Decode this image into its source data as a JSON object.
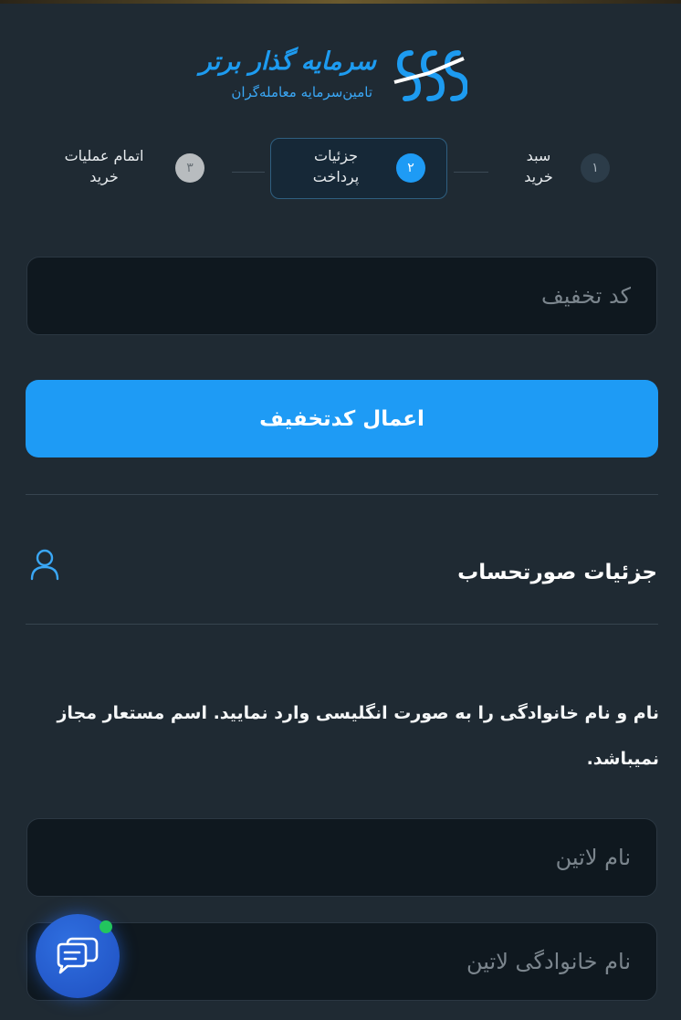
{
  "logo": {
    "title": "سرمایه گذار برتر",
    "subtitle": "تامین‌سرمایه معامله‌گران"
  },
  "stepper": {
    "steps": [
      {
        "number": "۱",
        "label_line1": "سبد",
        "label_line2": "خرید",
        "state": "done"
      },
      {
        "number": "۲",
        "label_line1": "جزئیات",
        "label_line2": "پرداخت",
        "state": "active"
      },
      {
        "number": "۳",
        "label_line1": "اتمام عملیات",
        "label_line2": "خرید",
        "state": "pending"
      }
    ]
  },
  "discount": {
    "placeholder": "کد تخفیف",
    "apply_label": "اعمال کدتخفیف"
  },
  "billing": {
    "title": "جزئیات صورتحساب",
    "notice": "نام و نام خانوادگی را به صورت انگلیسی وارد نمایید. اسم مستعار مجاز نمیباشد.",
    "first_name_placeholder": "نام لاتین",
    "last_name_placeholder": "نام خانوادگی لاتین"
  },
  "colors": {
    "background": "#1f2a33",
    "accent": "#1e9bf5",
    "online": "#22c55e"
  },
  "icons": {
    "user": "user-icon",
    "chat": "chat-icon"
  }
}
